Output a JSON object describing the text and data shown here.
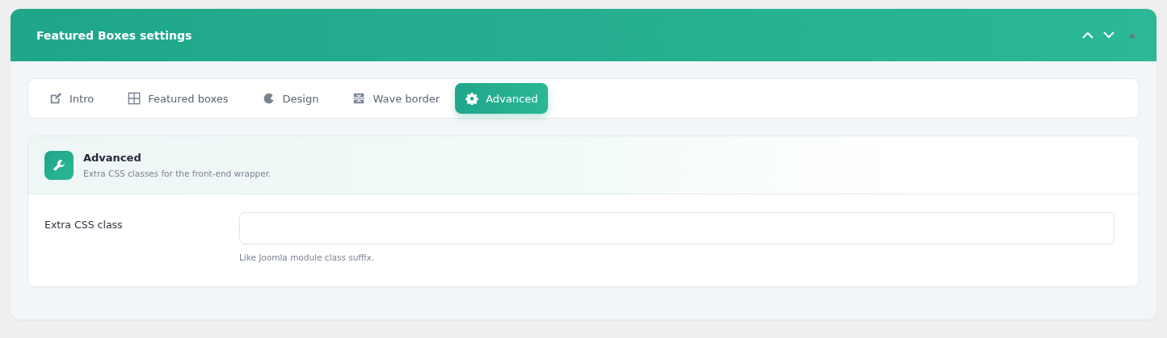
{
  "panel": {
    "title": "Featured Boxes settings"
  },
  "tabs": [
    {
      "label": "Intro",
      "kind": "edit",
      "selected": false
    },
    {
      "label": "Featured boxes",
      "kind": "grid",
      "selected": false
    },
    {
      "label": "Design",
      "kind": "palette",
      "selected": false
    },
    {
      "label": "Wave border",
      "kind": "wave",
      "selected": false
    },
    {
      "label": "Advanced",
      "kind": "gear",
      "selected": true
    }
  ],
  "section": {
    "title": "Advanced",
    "description": "Extra CSS classes for the front-end wrapper."
  },
  "fields": [
    {
      "label": "Extra CSS class",
      "hint": "Like Joomla module class suffix."
    }
  ]
}
